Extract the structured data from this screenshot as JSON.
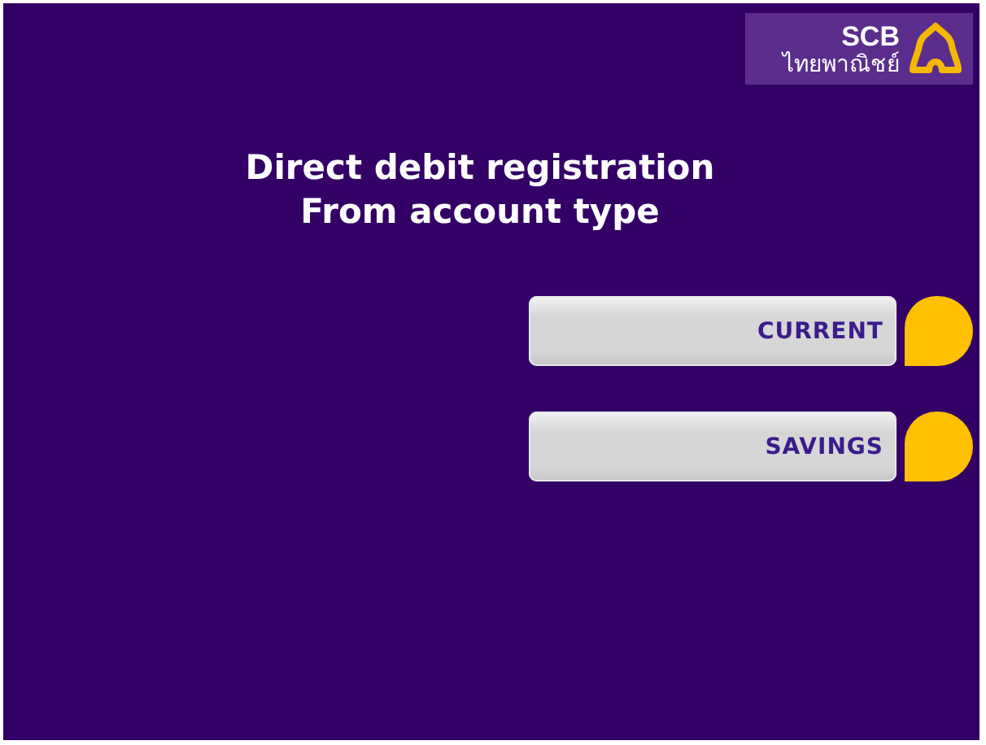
{
  "logo": {
    "name": "SCB",
    "thai_name": "ไทยพาณิชย์"
  },
  "title": [
    "Direct debit registration",
    "From account type"
  ],
  "options": [
    {
      "label": "CURRENT"
    },
    {
      "label": "SAVINGS"
    }
  ]
}
